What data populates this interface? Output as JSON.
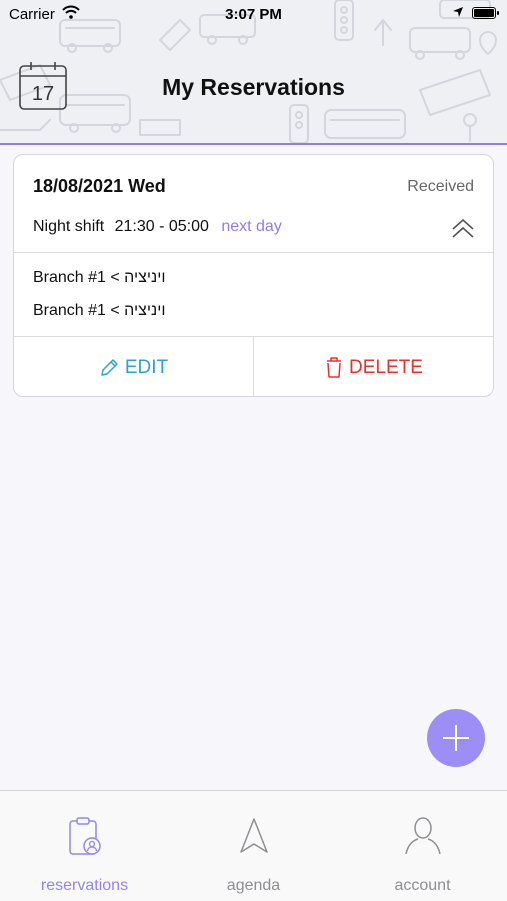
{
  "status_bar": {
    "carrier": "Carrier",
    "time": "3:07 PM"
  },
  "header": {
    "title": "My Reservations",
    "calendar_day": "17"
  },
  "reservation": {
    "date": "18/08/2021 Wed",
    "status": "Received",
    "shift_name": "Night shift",
    "shift_time": "21:30 - 05:00",
    "next_day": "next day",
    "routes": [
      "Branch #1 < ויניציה",
      "Branch #1 < ויניציה"
    ],
    "edit_label": "EDIT",
    "delete_label": "DELETE"
  },
  "tabs": [
    {
      "label": "reservations",
      "icon": "clipboard-user-icon",
      "active": true
    },
    {
      "label": "agenda",
      "icon": "navigation-arrow-icon",
      "active": false
    },
    {
      "label": "account",
      "icon": "person-icon",
      "active": false
    }
  ],
  "colors": {
    "accent": "#8b7ff0",
    "edit": "#2ba3cf",
    "delete": "#e8322e",
    "fab": "#9c8ef5"
  }
}
